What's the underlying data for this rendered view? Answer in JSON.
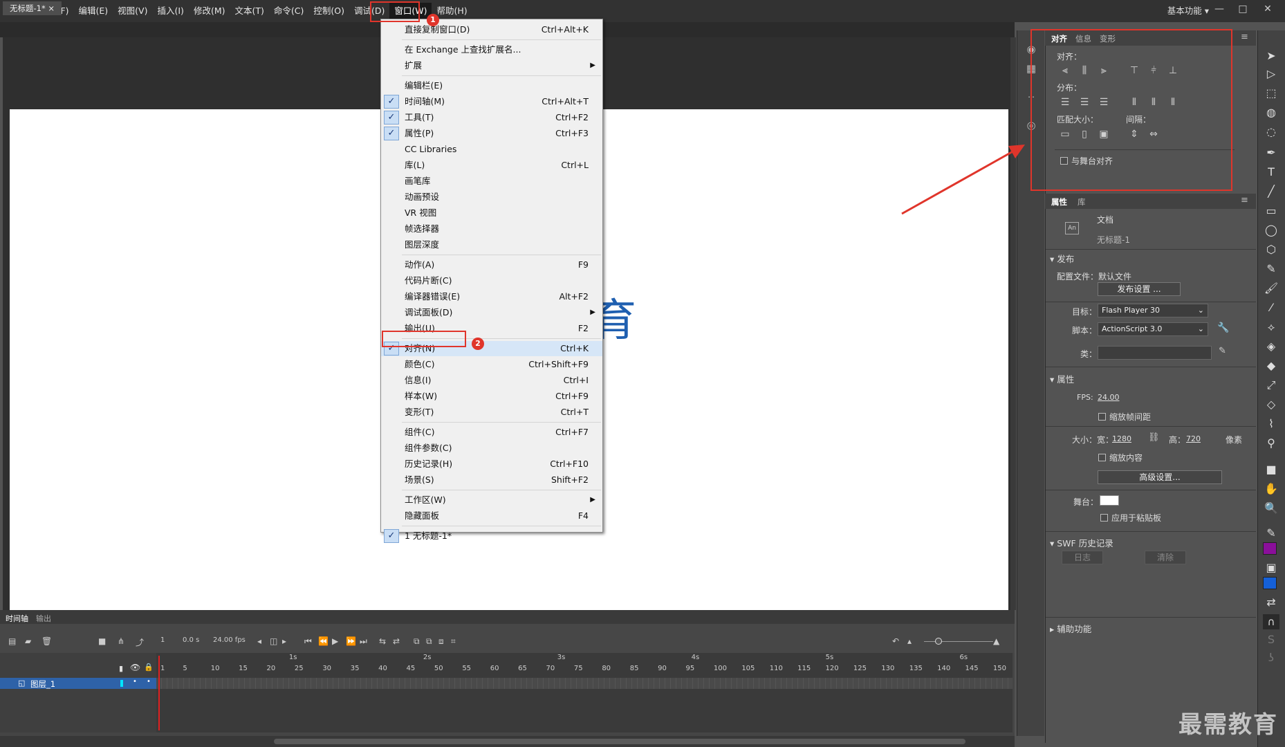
{
  "app": {
    "logo": "An",
    "workspace": "基本功能 ▾"
  },
  "menubar": [
    "文件(F)",
    "编辑(E)",
    "视图(V)",
    "插入(I)",
    "修改(M)",
    "文本(T)",
    "命令(C)",
    "控制(O)",
    "调试(D)",
    "窗口(W)",
    "帮助(H)"
  ],
  "document": {
    "tab": "无标题-1*",
    "stage_text": "育"
  },
  "window_menu": {
    "items": [
      {
        "label": "直接复制窗口(D)",
        "shortcut": "Ctrl+Alt+K",
        "checked": false
      },
      {
        "label": "在 Exchange 上查找扩展名...",
        "shortcut": "",
        "checked": false
      },
      {
        "label": "扩展",
        "shortcut": "",
        "checked": false,
        "submenu": true
      },
      {
        "label": "编辑栏(E)",
        "shortcut": "",
        "checked": false
      },
      {
        "label": "时间轴(M)",
        "shortcut": "Ctrl+Alt+T",
        "checked": true
      },
      {
        "label": "工具(T)",
        "shortcut": "Ctrl+F2",
        "checked": true
      },
      {
        "label": "属性(P)",
        "shortcut": "Ctrl+F3",
        "checked": true
      },
      {
        "label": "CC Libraries",
        "shortcut": "",
        "checked": false
      },
      {
        "label": "库(L)",
        "shortcut": "Ctrl+L",
        "checked": false
      },
      {
        "label": "画笔库",
        "shortcut": "",
        "checked": false
      },
      {
        "label": "动画预设",
        "shortcut": "",
        "checked": false
      },
      {
        "label": "VR 视图",
        "shortcut": "",
        "checked": false
      },
      {
        "label": "帧选择器",
        "shortcut": "",
        "checked": false
      },
      {
        "label": "图层深度",
        "shortcut": "",
        "checked": false
      },
      {
        "label": "动作(A)",
        "shortcut": "F9",
        "checked": false
      },
      {
        "label": "代码片断(C)",
        "shortcut": "",
        "checked": false
      },
      {
        "label": "编译器错误(E)",
        "shortcut": "Alt+F2",
        "checked": false
      },
      {
        "label": "调试面板(D)",
        "shortcut": "",
        "checked": false,
        "submenu": true
      },
      {
        "label": "输出(U)",
        "shortcut": "F2",
        "checked": false
      },
      {
        "label": "对齐(N)",
        "shortcut": "Ctrl+K",
        "checked": true
      },
      {
        "label": "颜色(C)",
        "shortcut": "Ctrl+Shift+F9",
        "checked": false
      },
      {
        "label": "信息(I)",
        "shortcut": "Ctrl+I",
        "checked": false
      },
      {
        "label": "样本(W)",
        "shortcut": "Ctrl+F9",
        "checked": false
      },
      {
        "label": "变形(T)",
        "shortcut": "Ctrl+T",
        "checked": false
      },
      {
        "label": "组件(C)",
        "shortcut": "Ctrl+F7",
        "checked": false
      },
      {
        "label": "组件参数(C)",
        "shortcut": "",
        "checked": false
      },
      {
        "label": "历史记录(H)",
        "shortcut": "Ctrl+F10",
        "checked": false
      },
      {
        "label": "场景(S)",
        "shortcut": "Shift+F2",
        "checked": false
      },
      {
        "label": "工作区(W)",
        "shortcut": "",
        "checked": false,
        "submenu": true
      },
      {
        "label": "隐藏面板",
        "shortcut": "F4",
        "checked": false
      },
      {
        "label": "1 无标题-1*",
        "shortcut": "",
        "checked": true
      }
    ]
  },
  "annotations": {
    "badge1": "1",
    "badge2": "2"
  },
  "align_panel": {
    "tabs": [
      "对齐",
      "信息",
      "变形"
    ],
    "align_label": "对齐：",
    "distribute_label": "分布：",
    "match_size_label": "匹配大小：",
    "spacing_label": "间隔：",
    "stage_align": "与舞台对齐"
  },
  "properties": {
    "tabs": [
      "属性",
      "库"
    ],
    "doc_label": "文档",
    "doc_name": "无标题-1",
    "publish_section": "发布",
    "profile_label": "配置文件：默认文件",
    "publish_settings": "发布设置 ...",
    "target_label": "目标：",
    "target_value": "Flash Player 30",
    "script_label": "脚本：",
    "script_value": "ActionScript 3.0",
    "class_label": "类：",
    "props_section": "属性",
    "fps_label": "FPS:",
    "fps_value": "24.00",
    "scale_spacing": "缩放帧间距",
    "size_label": "大小：宽：",
    "width": "1280",
    "height_label": "高：",
    "height": "720",
    "units": "像素",
    "scale_content": "缩放内容",
    "advanced": "高级设置...",
    "stage_label": "舞台：",
    "apply_paste": "应用于粘贴板",
    "swf_section": "SWF 历史记录",
    "log_btn": "日志",
    "clear_btn": "清除",
    "accessibility": "辅助功能"
  },
  "timeline": {
    "tabs": [
      "时间轴",
      "输出"
    ],
    "frame": "1",
    "time": "0.0 s",
    "fps": "24.00 fps",
    "layer_name": "图层_1",
    "seconds": [
      "1s",
      "2s",
      "3s",
      "4s",
      "5s",
      "6s"
    ],
    "frame_numbers": [
      "1",
      "5",
      "10",
      "15",
      "20",
      "25",
      "30",
      "35",
      "40",
      "45",
      "50",
      "55",
      "60",
      "65",
      "70",
      "75",
      "80",
      "85",
      "90",
      "95",
      "100",
      "105",
      "110",
      "115",
      "120",
      "125",
      "130",
      "135",
      "140",
      "145",
      "150"
    ]
  },
  "watermark": "最需教育",
  "colors": {
    "accent": "#e0352b",
    "stage_text": "#1f5fb0",
    "layer_sel": "#2e62a8"
  }
}
